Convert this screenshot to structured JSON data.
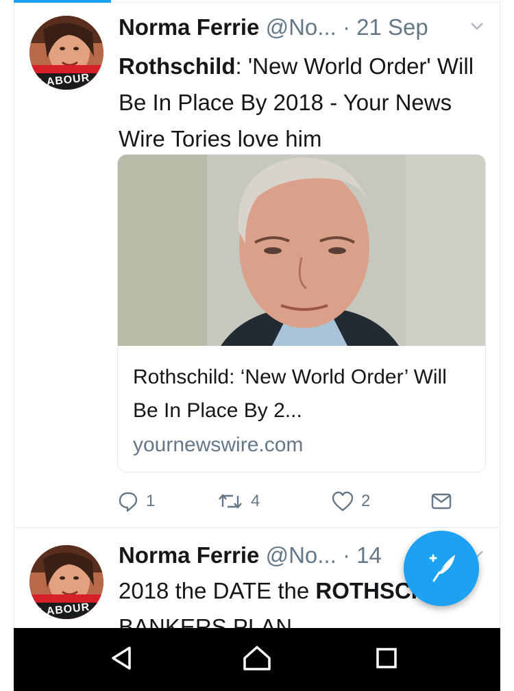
{
  "tweets": [
    {
      "name": "Norma Ferrie",
      "handle": "@No...",
      "time": "· 21 Sep",
      "text_bold": "Rothschild",
      "text_rest": ": 'New World Order' Will Be In Place By 2018 - Your News Wire Tories love him",
      "avatar_caption": "LABOUR",
      "card": {
        "title": "Rothschild: ‘New World Order’ Will Be In Place By 2...",
        "domain": "yournewswire.com"
      },
      "actions": {
        "replies": "1",
        "retweets": "4",
        "likes": "2"
      }
    },
    {
      "name": "Norma Ferrie",
      "handle": "@No...",
      "time": "· 14",
      "text_start": "2018 the DATE the ",
      "text_bold": "ROTHSCHILD",
      "text_end": " BANKERS PLAN",
      "avatar_caption": "LABOUR"
    }
  ],
  "colors": {
    "accent": "#1da1f2",
    "muted": "#657786",
    "text": "#14171a",
    "navbar": "#000000"
  },
  "icons": [
    "reply-icon",
    "retweet-icon",
    "like-icon",
    "message-icon",
    "compose-icon",
    "caret-down-icon",
    "nav-back-icon",
    "nav-home-icon",
    "nav-recents-icon"
  ]
}
